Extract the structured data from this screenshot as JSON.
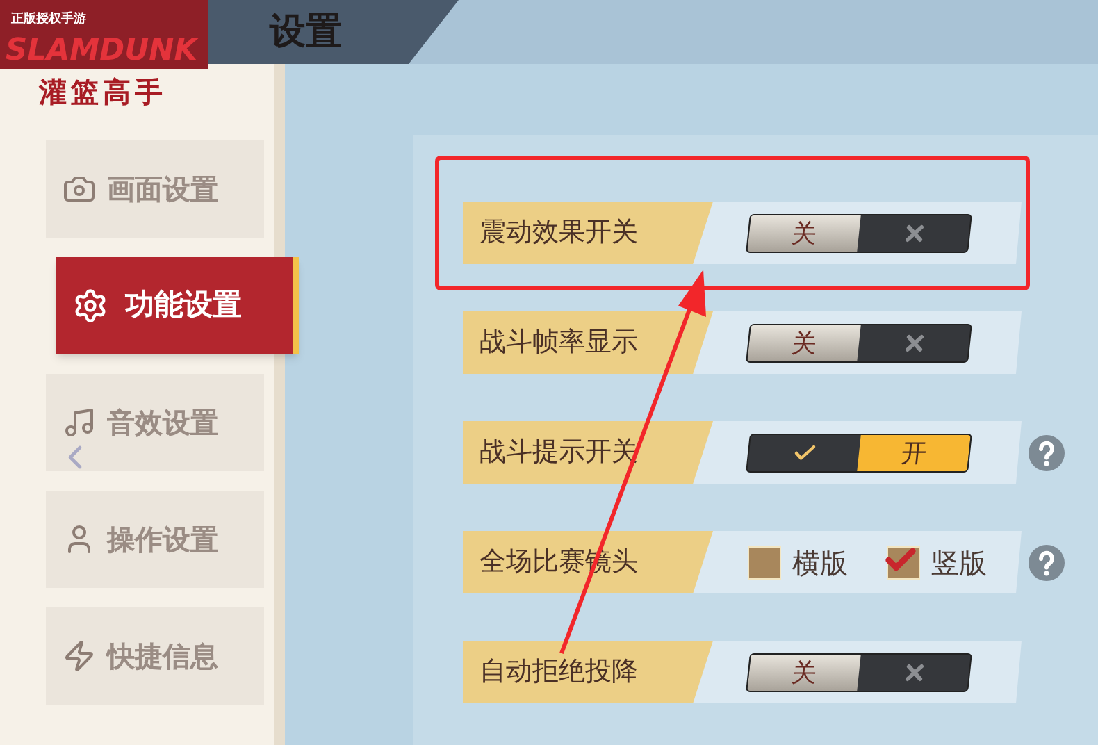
{
  "logo": {
    "tagline": "正版授权手游",
    "title": "SLAMDUNK",
    "subtitle": "灌篮高手"
  },
  "header": {
    "title": "设置"
  },
  "sidebar": {
    "items": [
      {
        "label": "画面设置",
        "selected": false
      },
      {
        "label": "功能设置",
        "selected": true
      },
      {
        "label": "音效设置",
        "selected": false
      },
      {
        "label": "操作设置",
        "selected": false
      },
      {
        "label": "快捷信息",
        "selected": false
      }
    ]
  },
  "settings": [
    {
      "kind": "toggle",
      "label": "震动效果开关",
      "on": false,
      "text": "关",
      "help": false,
      "highlighted": true
    },
    {
      "kind": "toggle",
      "label": "战斗帧率显示",
      "on": false,
      "text": "关",
      "help": false,
      "highlighted": false
    },
    {
      "kind": "toggle",
      "label": "战斗提示开关",
      "on": true,
      "text": "开",
      "help": true,
      "highlighted": false
    },
    {
      "kind": "choice",
      "label": "全场比赛镜头",
      "options": [
        {
          "label": "横版",
          "selected": false
        },
        {
          "label": "竖版",
          "selected": true
        }
      ],
      "help": true,
      "highlighted": false
    },
    {
      "kind": "toggle",
      "label": "自动拒绝投降",
      "on": false,
      "text": "关",
      "help": false,
      "highlighted": false
    }
  ]
}
